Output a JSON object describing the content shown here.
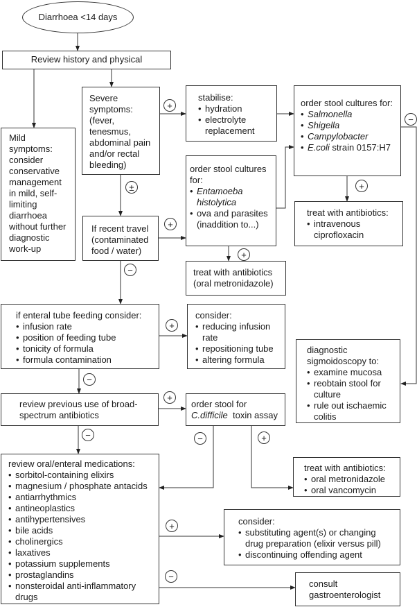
{
  "nodes": {
    "start": {
      "text": "Diarrhoea <14 days"
    },
    "review": {
      "text": "Review history and physical"
    },
    "mild": {
      "text": "Mild symptoms: consider conservative management in mild, self-limiting diarrhoea without further diagnostic work-up"
    },
    "severe": {
      "text": "Severe symptoms: (fever, tenesmus, abdominal pain and/or rectal bleeding)"
    },
    "stabilise": {
      "title": "stabilise:",
      "items": [
        "hydration",
        "electrolyte replacement"
      ]
    },
    "cultures": {
      "title": "order stool cultures for:",
      "items": [
        {
          "i": "Salmonella",
          "t": ""
        },
        {
          "i": "Shigella",
          "t": ""
        },
        {
          "i": "Campylobacter",
          "t": ""
        },
        {
          "i": "E.coli",
          "t": " strain 0157:H7"
        }
      ]
    },
    "travel": {
      "text": "If recent travel (contaminated food / water)"
    },
    "ova": {
      "title": "order stool cultures for:",
      "items": [
        {
          "i": "Entamoeba histolytica",
          "t": ""
        },
        "ova and parasites (inaddition to...)"
      ]
    },
    "cipro": {
      "title": "treat with antibiotics:",
      "items": [
        "intravenous ciprofloxacin"
      ]
    },
    "oral_metro": {
      "text": "treat with antibiotics (oral metronidazole)"
    },
    "enteral": {
      "title": "if enteral tube feeding consider:",
      "items": [
        "infusion rate",
        "position of feeding tube",
        "tonicity of formula",
        "formula contamination"
      ]
    },
    "consider_infusion": {
      "title": "consider:",
      "items": [
        "reducing infusion rate",
        "repositioning tube",
        "altering formula"
      ]
    },
    "sigmoidoscopy": {
      "title": "diagnostic sigmoidoscopy to:",
      "items": [
        "examine mucosa",
        "reobtain stool for culture",
        "rule out ischaemic colitis"
      ]
    },
    "broad": {
      "text": "review previous use of broad-spectrum antibiotics"
    },
    "cdiff": {
      "line1": "order stool for",
      "italic": "C.difficile",
      "rest": "  toxin assay"
    },
    "oral_abx": {
      "title": "treat with antibiotics:",
      "items": [
        "oral metronidazole",
        "oral vancomycin"
      ]
    },
    "meds": {
      "title": "review oral/enteral medications:",
      "items": [
        "sorbitol-containing elixirs",
        "magnesium / phosphate antacids",
        "antiarrhythmics",
        "antineoplastics",
        "antihypertensives",
        "bile acids",
        "cholinergics",
        "laxatives",
        "potassium supplements",
        "prostaglandins",
        "nonsteroidal anti-inflammatory drugs"
      ]
    },
    "consider_agents": {
      "title": "consider:",
      "items": [
        "substituting agent(s) or changing drug preparation (elixir versus pill)",
        "discontinuing offending agent"
      ]
    },
    "consult": {
      "text": "consult gastroenterologist"
    }
  },
  "edge_labels": {
    "severe_stabilise": "+",
    "cultures_sigmoid": "−",
    "severe_travel": "±",
    "travel_ova": "+",
    "cultures_cipro": "+",
    "ova_metro": "+",
    "travel_enteral": "−",
    "enteral_consider": "+",
    "enteral_broad": "−",
    "broad_cdiff": "+",
    "broad_meds": "−",
    "cdiff_meds": "−",
    "cdiff_abx": "+",
    "meds_consider": "+",
    "meds_consult": "−"
  }
}
